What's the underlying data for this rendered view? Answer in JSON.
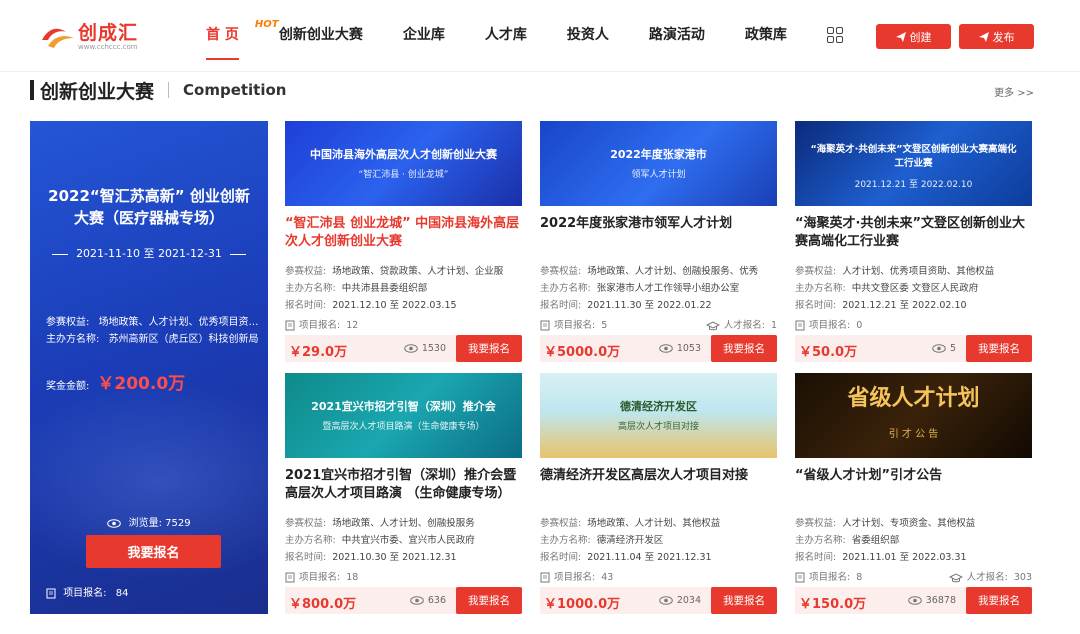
{
  "header": {
    "logo_text": "创成汇",
    "logo_url": "www.cchccc.com",
    "nav": [
      {
        "label": "首 页",
        "active": true
      },
      {
        "label": "创新创业大赛",
        "badge": "HOT"
      },
      {
        "label": "企业库"
      },
      {
        "label": "人才库"
      },
      {
        "label": "投资人"
      },
      {
        "label": "路演活动"
      },
      {
        "label": "政策库"
      }
    ],
    "create_label": "创建",
    "publish_label": "发布"
  },
  "section": {
    "title": "创新创业大赛",
    "title_en": "Competition",
    "more": "更多 >>"
  },
  "feature": {
    "title": "2022“智汇苏高新” 创业创新大赛（医疗器械专场）",
    "date": "2021-11-10 至 2021-12-31",
    "benefits_label": "参赛权益:",
    "benefits": "场地政策、人才计划、优秀项目资…",
    "organizer_label": "主办方名称:",
    "organizer": "苏州高新区（虎丘区）科技创新局",
    "prize_label": "奖金金额:",
    "prize": "￥200.0万",
    "views_label": "浏览量:",
    "views": "7529",
    "signup_button": "我要报名",
    "signup_count_label": "项目报名:",
    "signup_count": "84"
  },
  "labels": {
    "benefits": "参赛权益:",
    "organizer": "主办方名称:",
    "time": "报名时间:",
    "project_signup": "项目报名:",
    "talent_signup": "人才报名:",
    "signup_button": "我要报名"
  },
  "cards": [
    {
      "image_text": "中国沛县海外高层次人才创新创业大赛",
      "image_sub": "“智汇沛县 · 创业龙城”",
      "title": "“智汇沛县 创业龙城” 中国沛县海外高层次人才创新创业大赛",
      "title_red": true,
      "benefits": "场地政策、贷款政策、人才计划、企业服",
      "organizer": "中共沛县县委组织部",
      "time": "2021.12.10 至 2022.03.15",
      "project_signup": "12",
      "talent_signup": "",
      "price": "￥29.0万",
      "views": "1530"
    },
    {
      "image_text": "2022年度张家港市",
      "image_sub": "领军人才计划",
      "title": "2022年度张家港市领军人才计划",
      "title_red": false,
      "benefits": "场地政策、人才计划、创融投服务、优秀",
      "organizer": "张家港市人才工作领导小组办公室",
      "time": "2021.11.30 至 2022.01.22",
      "project_signup": "5",
      "talent_signup": "1",
      "price": "￥5000.0万",
      "views": "1053"
    },
    {
      "image_text": "“海聚英才·共创未来”文登区创新创业大赛高端化工行业赛",
      "image_sub": "2021.12.21 至 2022.02.10",
      "title": "“海聚英才·共创未来”文登区创新创业大赛高端化工行业赛",
      "title_red": false,
      "benefits": "人才计划、优秀项目资助、其他权益",
      "organizer": "中共文登区委 文登区人民政府",
      "time": "2021.12.21 至 2022.02.10",
      "project_signup": "0",
      "talent_signup": "",
      "price": "￥50.0万",
      "views": "5"
    },
    {
      "image_text": "2021宜兴市招才引智（深圳）推介会",
      "image_sub": "暨高层次人才项目路演（生命健康专场）",
      "title": "2021宜兴市招才引智（深圳）推介会暨高层次人才项目路演 （生命健康专场）",
      "title_red": false,
      "benefits": "场地政策、人才计划、创融投服务",
      "organizer": "中共宜兴市委、宜兴市人民政府",
      "time": "2021.10.30 至 2021.12.31",
      "project_signup": "18",
      "talent_signup": "",
      "price": "￥800.0万",
      "views": "636"
    },
    {
      "image_text": "德清经济开发区",
      "image_sub": "高层次人才项目对接",
      "title": "德清经济开发区高层次人才项目对接",
      "title_red": false,
      "benefits": "场地政策、人才计划、其他权益",
      "organizer": "德清经济开发区",
      "time": "2021.11.04 至 2021.12.31",
      "project_signup": "43",
      "talent_signup": "",
      "price": "￥1000.0万",
      "views": "2034"
    },
    {
      "image_text": "省级人才计划",
      "image_sub": "引 才 公 告",
      "title": "“省级人才计划”引才公告",
      "title_red": false,
      "benefits": "人才计划、专项资金、其他权益",
      "organizer": "省委组织部",
      "time": "2021.11.01 至 2022.03.31",
      "project_signup": "8",
      "talent_signup": "303",
      "price": "￥150.0万",
      "views": "36878"
    }
  ]
}
